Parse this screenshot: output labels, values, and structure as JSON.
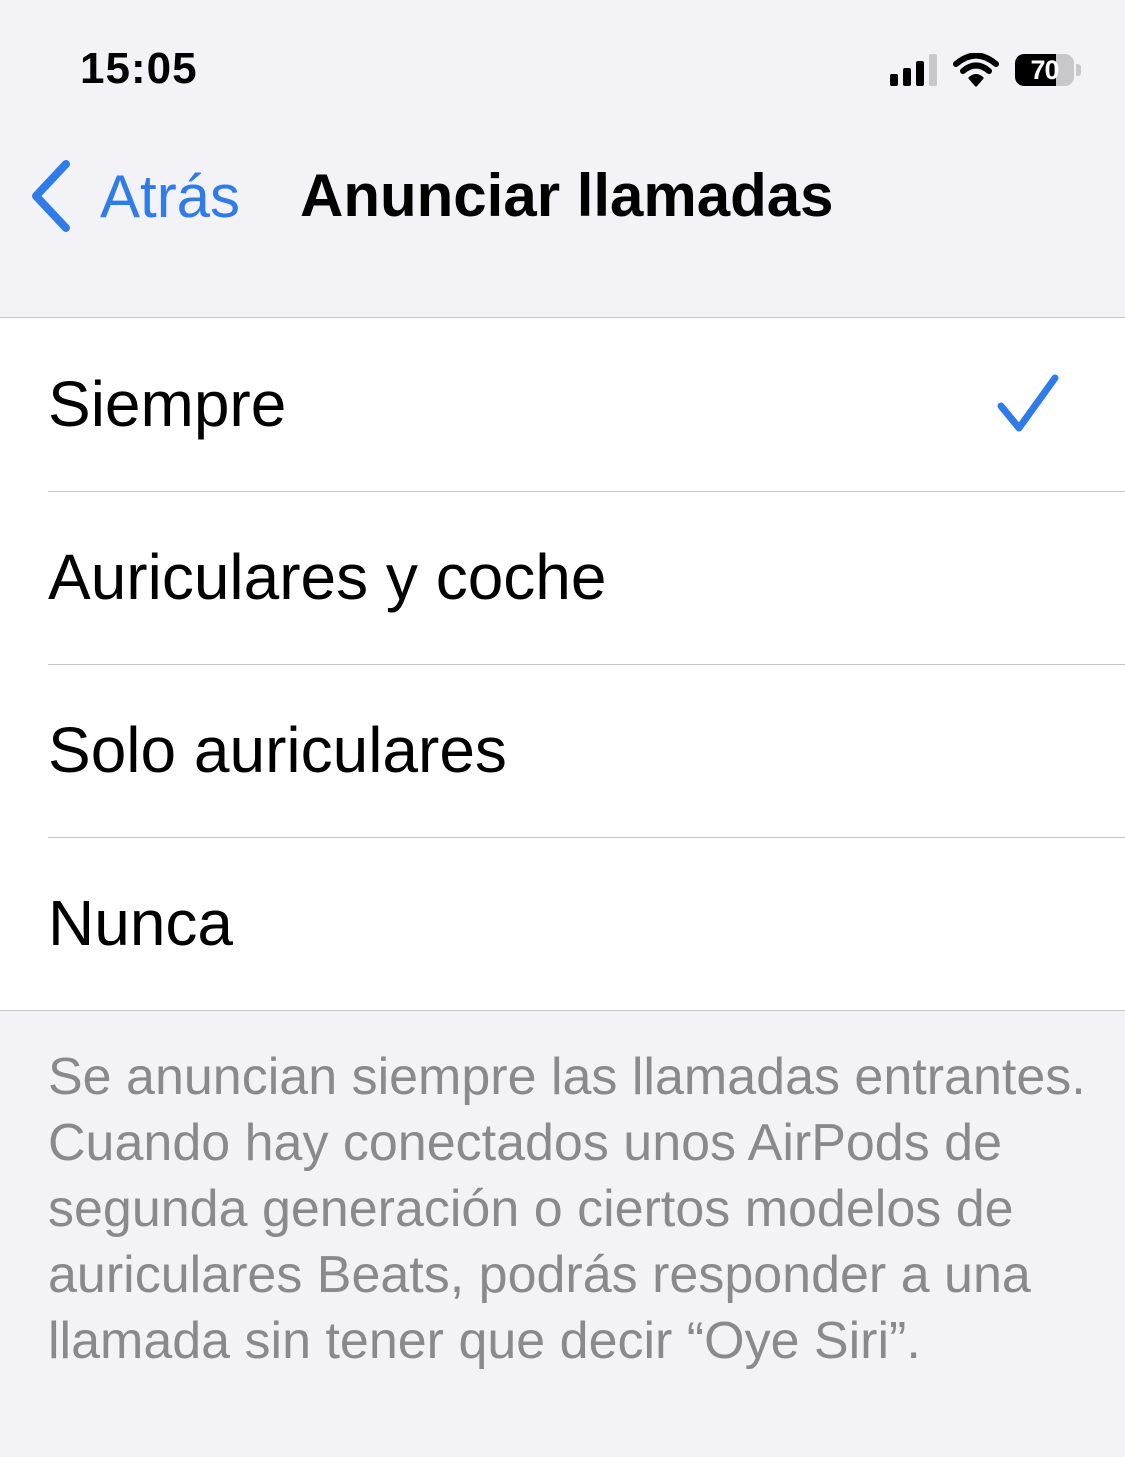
{
  "status_bar": {
    "time": "15:05",
    "battery_level": "70",
    "battery_fraction": 0.7,
    "signal_bars": 3,
    "signal_bars_total": 4,
    "icons": [
      "cellular-signal-icon",
      "wifi-icon",
      "battery-icon"
    ]
  },
  "nav": {
    "back_label": "Atrás",
    "title": "Anunciar llamadas",
    "back_icon": "chevron-left-icon"
  },
  "options": [
    {
      "label": "Siempre",
      "selected": true
    },
    {
      "label": "Auriculares y coche",
      "selected": false
    },
    {
      "label": "Solo auriculares",
      "selected": false
    },
    {
      "label": "Nunca",
      "selected": false
    }
  ],
  "footer": {
    "note": "Se anuncian siempre las llamadas entrantes. Cuando hay conectados unos AirPods de segunda generación o ciertos modelos de auriculares Beats, podrás responder a una llamada sin tener que decir “Oye Siri”."
  },
  "colors": {
    "accent": "#2f7bea",
    "background": "#f2f2f7",
    "row_background": "#ffffff",
    "separator": "#c6c6c8",
    "footer_text": "#8a8a8e"
  }
}
